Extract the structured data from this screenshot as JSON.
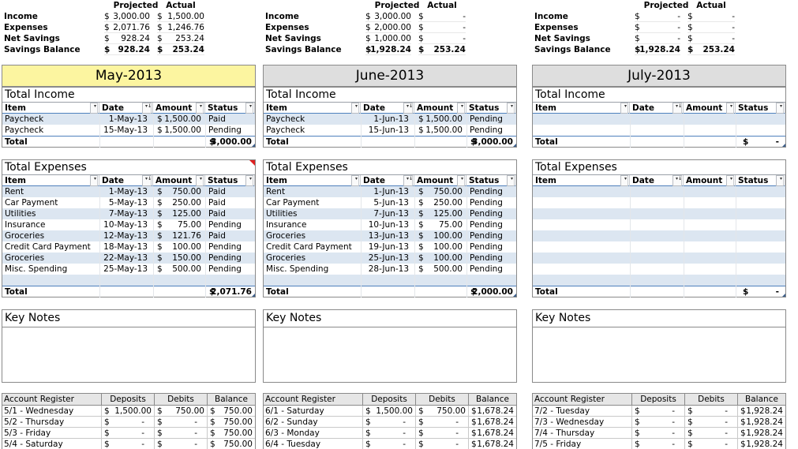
{
  "colors": {
    "may_header_bg": "#fcf5a0",
    "other_header_bg": "#dedede",
    "band": "#dce6f1",
    "accent": "#4f81bd",
    "flag": "#e02020"
  },
  "columns": [
    {
      "summary": {
        "projected_label": "Projected",
        "actual_label": "Actual",
        "rows": [
          {
            "label": "Income",
            "proj_sym": "$",
            "projected": "3,000.00",
            "act_sym": "$",
            "actual": "1,500.00"
          },
          {
            "label": "Expenses",
            "proj_sym": "$",
            "projected": "2,071.76",
            "act_sym": "$",
            "actual": "1,246.76"
          },
          {
            "label": "Net Savings",
            "proj_sym": "$",
            "projected": "928.24",
            "act_sym": "$",
            "actual": "253.24"
          },
          {
            "label": "Savings Balance",
            "proj_sym": "$",
            "projected": "928.24",
            "act_sym": "$",
            "actual": "253.24"
          }
        ]
      },
      "month": "May-2013",
      "income": {
        "title": "Total Income",
        "headers": {
          "item": "Item",
          "date": "Date",
          "amount": "Amount",
          "status": "Status"
        },
        "rows": [
          {
            "item": "Paycheck",
            "date": "1-May-13",
            "sym": "$",
            "amount": "1,500.00",
            "status": "Paid"
          },
          {
            "item": "Paycheck",
            "date": "15-May-13",
            "sym": "$",
            "amount": "1,500.00",
            "status": "Pending"
          }
        ],
        "total_label": "Total",
        "total_sym": "$",
        "total": "3,000.00"
      },
      "expenses": {
        "title": "Total Expenses",
        "headers": {
          "item": "Item",
          "date": "Date",
          "amount": "Amount",
          "status": "Status"
        },
        "rows": [
          {
            "item": "Rent",
            "date": "1-May-13",
            "sym": "$",
            "amount": "750.00",
            "status": "Paid"
          },
          {
            "item": "Car Payment",
            "date": "5-May-13",
            "sym": "$",
            "amount": "250.00",
            "status": "Paid"
          },
          {
            "item": "Utilities",
            "date": "7-May-13",
            "sym": "$",
            "amount": "125.00",
            "status": "Paid"
          },
          {
            "item": "Insurance",
            "date": "10-May-13",
            "sym": "$",
            "amount": "75.00",
            "status": "Pending"
          },
          {
            "item": "Groceries",
            "date": "12-May-13",
            "sym": "$",
            "amount": "121.76",
            "status": "Paid"
          },
          {
            "item": "Credit Card Payment",
            "date": "18-May-13",
            "sym": "$",
            "amount": "100.00",
            "status": "Pending"
          },
          {
            "item": "Groceries",
            "date": "22-May-13",
            "sym": "$",
            "amount": "150.00",
            "status": "Pending"
          },
          {
            "item": "Misc. Spending",
            "date": "25-May-13",
            "sym": "$",
            "amount": "500.00",
            "status": "Pending"
          }
        ],
        "total_label": "Total",
        "total_sym": "$",
        "total": "2,071.76"
      },
      "notes_title": "Key Notes",
      "register": {
        "headers": {
          "name": "Account Register",
          "deposits": "Deposits",
          "debits": "Debits",
          "balance": "Balance"
        },
        "rows": [
          {
            "day": "5/1 - Wednesday",
            "dep": "1,500.00",
            "deb": "750.00",
            "bal": "750.00"
          },
          {
            "day": "5/2 - Thursday",
            "dep": "-",
            "deb": "-",
            "bal": "750.00"
          },
          {
            "day": "5/3 - Friday",
            "dep": "-",
            "deb": "-",
            "bal": "750.00"
          },
          {
            "day": "5/4 - Saturday",
            "dep": "-",
            "deb": "-",
            "bal": "750.00"
          }
        ]
      }
    },
    {
      "summary": {
        "projected_label": "Projected",
        "actual_label": "Actual",
        "rows": [
          {
            "label": "Income",
            "proj_sym": "$",
            "projected": "3,000.00",
            "act_sym": "$",
            "actual": "-"
          },
          {
            "label": "Expenses",
            "proj_sym": "$",
            "projected": "2,000.00",
            "act_sym": "$",
            "actual": "-"
          },
          {
            "label": "Net Savings",
            "proj_sym": "$",
            "projected": "1,000.00",
            "act_sym": "$",
            "actual": "-"
          },
          {
            "label": "Savings Balance",
            "proj_sym": "$",
            "projected": "1,928.24",
            "act_sym": "$",
            "actual": "253.24"
          }
        ]
      },
      "month": "June-2013",
      "income": {
        "title": "Total Income",
        "headers": {
          "item": "Item",
          "date": "Date",
          "amount": "Amount",
          "status": "Status"
        },
        "rows": [
          {
            "item": "Paycheck",
            "date": "1-Jun-13",
            "sym": "$",
            "amount": "1,500.00",
            "status": "Pending"
          },
          {
            "item": "Paycheck",
            "date": "15-Jun-13",
            "sym": "$",
            "amount": "1,500.00",
            "status": "Pending"
          }
        ],
        "total_label": "Total",
        "total_sym": "$",
        "total": "3,000.00"
      },
      "expenses": {
        "title": "Total Expenses",
        "headers": {
          "item": "Item",
          "date": "Date",
          "amount": "Amount",
          "status": "Status"
        },
        "rows": [
          {
            "item": "Rent",
            "date": "1-Jun-13",
            "sym": "$",
            "amount": "750.00",
            "status": "Pending"
          },
          {
            "item": "Car Payment",
            "date": "5-Jun-13",
            "sym": "$",
            "amount": "250.00",
            "status": "Pending"
          },
          {
            "item": "Utilities",
            "date": "7-Jun-13",
            "sym": "$",
            "amount": "125.00",
            "status": "Pending"
          },
          {
            "item": "Insurance",
            "date": "10-Jun-13",
            "sym": "$",
            "amount": "75.00",
            "status": "Pending"
          },
          {
            "item": "Groceries",
            "date": "13-Jun-13",
            "sym": "$",
            "amount": "100.00",
            "status": "Pending"
          },
          {
            "item": "Credit Card Payment",
            "date": "19-Jun-13",
            "sym": "$",
            "amount": "100.00",
            "status": "Pending"
          },
          {
            "item": "Groceries",
            "date": "25-Jun-13",
            "sym": "$",
            "amount": "100.00",
            "status": "Pending"
          },
          {
            "item": "Misc. Spending",
            "date": "28-Jun-13",
            "sym": "$",
            "amount": "500.00",
            "status": "Pending"
          }
        ],
        "total_label": "Total",
        "total_sym": "$",
        "total": "2,000.00"
      },
      "notes_title": "Key Notes",
      "register": {
        "headers": {
          "name": "Account Register",
          "deposits": "Deposits",
          "debits": "Debits",
          "balance": "Balance"
        },
        "rows": [
          {
            "day": "6/1 - Saturday",
            "dep": "1,500.00",
            "deb": "750.00",
            "bal": "1,678.24"
          },
          {
            "day": "6/2 - Sunday",
            "dep": "-",
            "deb": "-",
            "bal": "1,678.24"
          },
          {
            "day": "6/3 - Monday",
            "dep": "-",
            "deb": "-",
            "bal": "1,678.24"
          },
          {
            "day": "6/4 - Tuesday",
            "dep": "-",
            "deb": "-",
            "bal": "1,678.24"
          }
        ]
      }
    },
    {
      "summary": {
        "projected_label": "Projected",
        "actual_label": "Actual",
        "rows": [
          {
            "label": "Income",
            "proj_sym": "$",
            "projected": "-",
            "act_sym": "$",
            "actual": "-"
          },
          {
            "label": "Expenses",
            "proj_sym": "$",
            "projected": "-",
            "act_sym": "$",
            "actual": "-"
          },
          {
            "label": "Net Savings",
            "proj_sym": "$",
            "projected": "-",
            "act_sym": "$",
            "actual": "-"
          },
          {
            "label": "Savings Balance",
            "proj_sym": "$",
            "projected": "1,928.24",
            "act_sym": "$",
            "actual": "253.24"
          }
        ]
      },
      "month": "July-2013",
      "income": {
        "title": "Total Income",
        "headers": {
          "item": "Item",
          "date": "Date",
          "amount": "Amount",
          "status": "Status"
        },
        "rows": [],
        "total_label": "Total",
        "total_sym": "$",
        "total": "-"
      },
      "expenses": {
        "title": "Total Expenses",
        "headers": {
          "item": "Item",
          "date": "Date",
          "amount": "Amount",
          "status": "Status"
        },
        "rows": [],
        "total_label": "Total",
        "total_sym": "$",
        "total": "-"
      },
      "notes_title": "Key Notes",
      "register": {
        "headers": {
          "name": "Account Register",
          "deposits": "Deposits",
          "debits": "Debits",
          "balance": "Balance"
        },
        "rows": [
          {
            "day": "7/2 - Tuesday",
            "dep": "-",
            "deb": "-",
            "bal": "1,928.24"
          },
          {
            "day": "7/3 - Wednesday",
            "dep": "-",
            "deb": "-",
            "bal": "1,928.24"
          },
          {
            "day": "7/4 - Thursday",
            "dep": "-",
            "deb": "-",
            "bal": "1,928.24"
          },
          {
            "day": "7/5 - Friday",
            "dep": "-",
            "deb": "-",
            "bal": "1,928.24"
          }
        ]
      }
    }
  ]
}
